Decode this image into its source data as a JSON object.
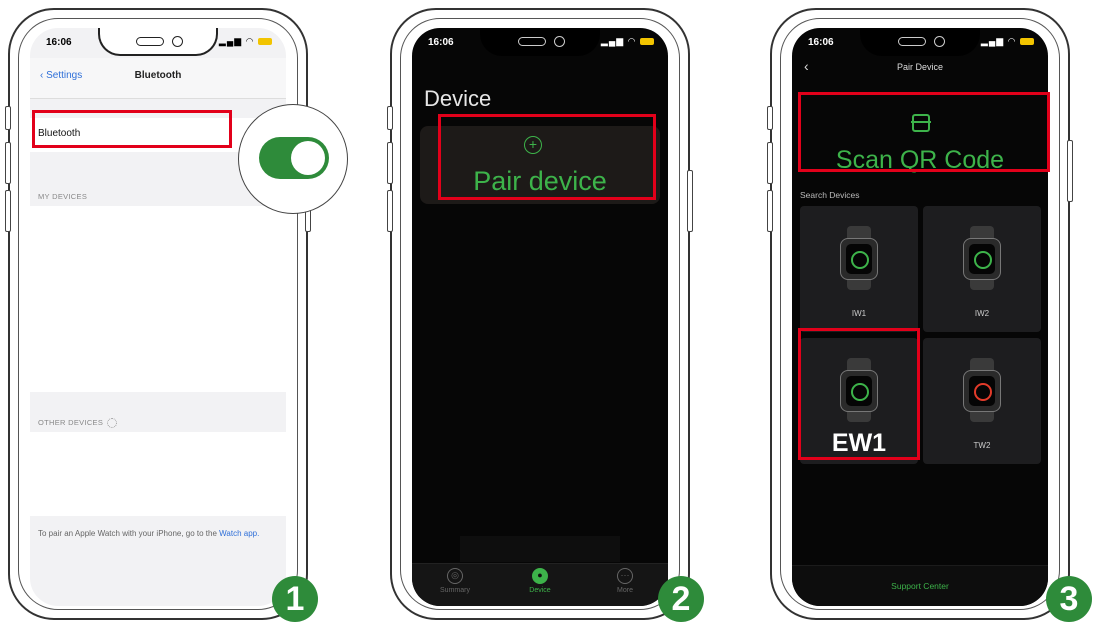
{
  "status_time": "16:06",
  "phone1": {
    "nav": {
      "back_label": "Settings",
      "title": "Bluetooth"
    },
    "bluetooth_row_label": "Bluetooth",
    "toggle_on": true,
    "my_devices_header": "MY DEVICES",
    "other_devices_header": "OTHER DEVICES",
    "footer_text": "To pair an Apple Watch with your iPhone, go to the",
    "footer_link": "Watch app."
  },
  "phone2": {
    "title": "Device",
    "pair_device_label": "Pair device",
    "tabs": [
      {
        "label": "Summary",
        "icon": "summary-icon"
      },
      {
        "label": "Device",
        "icon": "device-icon"
      },
      {
        "label": "More",
        "icon": "more-icon"
      }
    ]
  },
  "phone3": {
    "title": "Pair Device",
    "scan_label": "Scan QR Code",
    "search_header": "Search Devices",
    "devices": [
      {
        "label": "IW1"
      },
      {
        "label": "IW2"
      },
      {
        "label": "EW1"
      },
      {
        "label": "TW2"
      }
    ],
    "support_label": "Support Center"
  },
  "steps": [
    "1",
    "2",
    "3"
  ],
  "colors": {
    "accent_green": "#3db34a",
    "highlight_red": "#e2001a",
    "badge_green": "#2e8b3a",
    "ios_blue": "#2e6fd8"
  }
}
